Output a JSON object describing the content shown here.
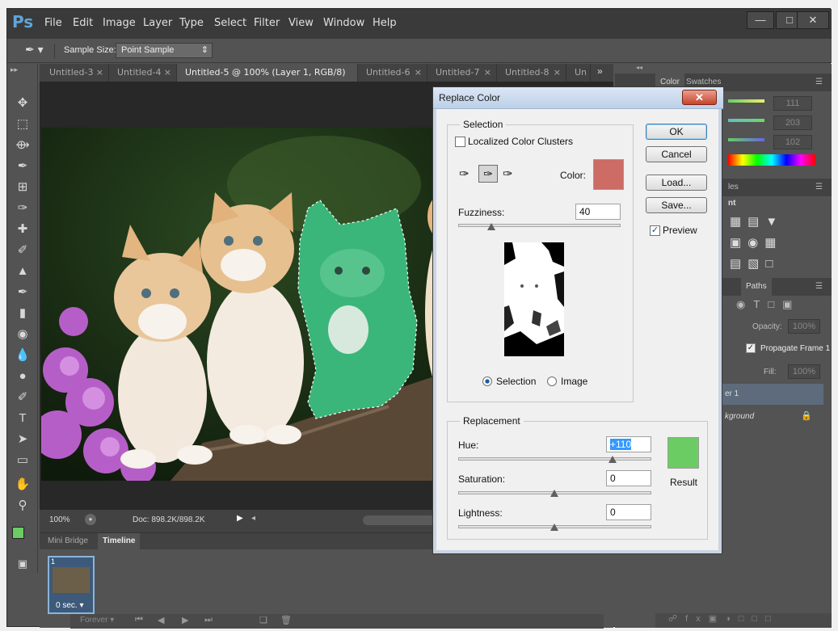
{
  "app": {
    "logo": "Ps",
    "menu": [
      "File",
      "Edit",
      "Image",
      "Layer",
      "Type",
      "Select",
      "Filter",
      "View",
      "Window",
      "Help"
    ]
  },
  "options_bar": {
    "sample_size_label": "Sample Size:",
    "sample_size_value": "Point Sample"
  },
  "doc_tabs": [
    "Untitled-3",
    "Untitled-4",
    "Untitled-5 @ 100% (Layer 1, RGB/8) *",
    "Untitled-6",
    "Untitled-7",
    "Untitled-8",
    "Un"
  ],
  "status": {
    "zoom": "100%",
    "doc": "Doc: 898.2K/898.2K"
  },
  "timeline": {
    "tabs": [
      "Mini Bridge",
      "Timeline"
    ],
    "frame_number": "1",
    "frame_delay": "0 sec.",
    "loop": "Forever"
  },
  "right_panels": {
    "color_tabs": [
      "Color",
      "Swatches"
    ],
    "color_values": [
      "111",
      "203",
      "102"
    ],
    "adjust_fragment_1": "les",
    "adjust_fragment_2": "nt",
    "layers_tab": "Paths",
    "opacity_label": "Opacity:",
    "opacity_value": "100%",
    "fill_label": "Fill:",
    "fill_value": "100%",
    "propagate_label": "Propagate Frame 1",
    "layer_1_fragment": "er 1",
    "layer_bg_fragment": "kground"
  },
  "dialog": {
    "title": "Replace Color",
    "selection_group": "Selection",
    "localized_label": "Localized Color Clusters",
    "color_label": "Color:",
    "color_swatch": "#cd6b65",
    "fuzziness_label": "Fuzziness:",
    "fuzziness_value": "40",
    "fuzziness_fraction": 0.2,
    "radio_selection": "Selection",
    "radio_image": "Image",
    "replacement_group": "Replacement",
    "hue_label": "Hue:",
    "hue_value": "+110",
    "saturation_label": "Saturation:",
    "saturation_value": "0",
    "lightness_label": "Lightness:",
    "lightness_value": "0",
    "result_label": "Result",
    "result_swatch": "#6ccc64",
    "buttons": {
      "ok": "OK",
      "cancel": "Cancel",
      "load": "Load...",
      "save": "Save..."
    },
    "preview_label": "Preview"
  },
  "colors": {
    "foreground": "#6ccc64",
    "background": "#ffffff"
  }
}
